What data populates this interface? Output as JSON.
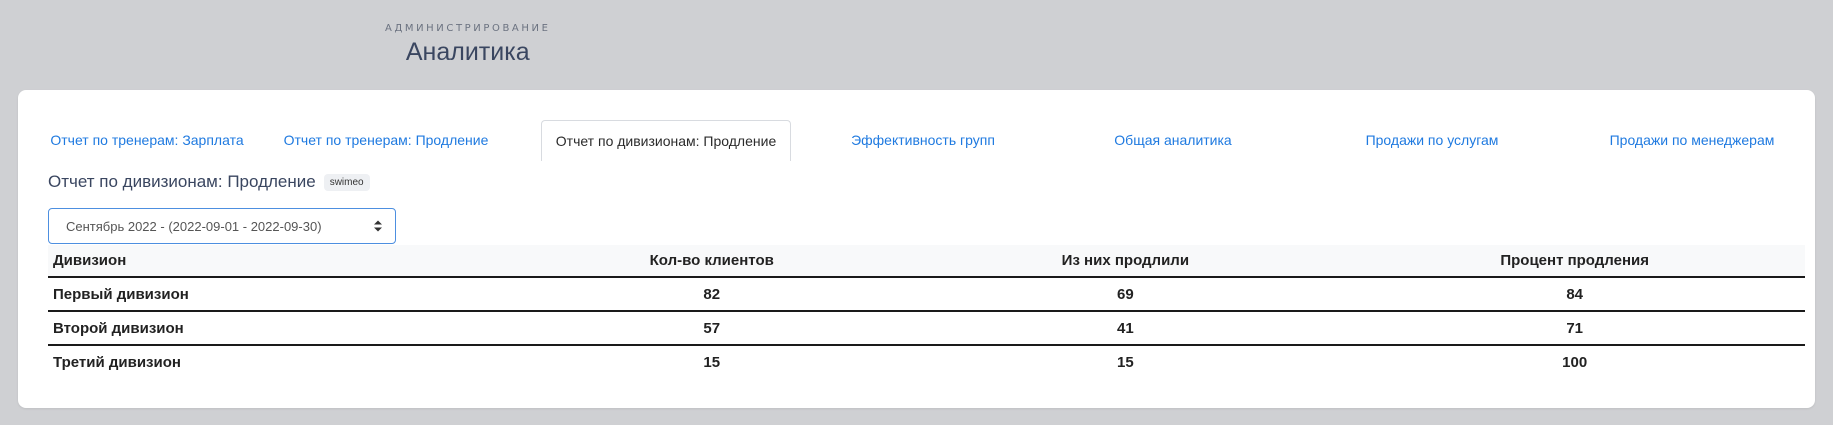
{
  "header": {
    "pretitle": "АДМИНИСТРИРОВАНИЕ",
    "title": "Аналитика"
  },
  "tabs": [
    {
      "label": "Отчет по тренерам: Зарплата",
      "active": false
    },
    {
      "label": "Отчет по тренерам: Продление",
      "active": false
    },
    {
      "label": "Отчет по дивизионам: Продление",
      "active": true
    },
    {
      "label": "Эффективность групп",
      "active": false
    },
    {
      "label": "Общая аналитика",
      "active": false
    },
    {
      "label": "Продажи по услугам",
      "active": false
    },
    {
      "label": "Продажи по менеджерам",
      "active": false
    }
  ],
  "section": {
    "title": "Отчет по дивизионам: Продление",
    "badge": "swimeo"
  },
  "period_select": {
    "value": "Сентябрь 2022 - (2022-09-01 - 2022-09-30)"
  },
  "table": {
    "headers": [
      "Дивизион",
      "Кол-во клиентов",
      "Из них продлили",
      "Процент продления"
    ],
    "rows": [
      [
        "Первый дивизион",
        "82",
        "69",
        "84"
      ],
      [
        "Второй дивизион",
        "57",
        "41",
        "71"
      ],
      [
        "Третий дивизион",
        "15",
        "15",
        "100"
      ]
    ]
  },
  "colors": {
    "background": "#cfd0d3",
    "link": "#1f7ae0",
    "title": "#3a4660"
  }
}
